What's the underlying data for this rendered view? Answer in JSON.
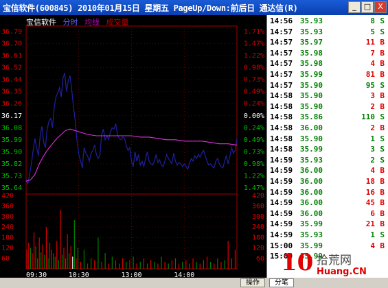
{
  "window": {
    "title": "宝信软件(600845) 2010年01月15日 星期五 PageUp/Down:前后日 通达信(R)",
    "btn_min": "_",
    "btn_max": "□",
    "btn_close": "X"
  },
  "legend": {
    "name": "宝信软件",
    "timeframe": "分时",
    "avg_line": "均线",
    "volume": "成交量"
  },
  "colors": {
    "price_line": "#2020a0",
    "avg_line": "#e030e0",
    "up": "#e00000",
    "down": "#008000",
    "neutral": "#000000"
  },
  "chart_data": [
    {
      "type": "line",
      "title": "",
      "x_ticks": [
        "09:30",
        "10:30",
        "13:00",
        "14:00"
      ],
      "y_left_ticks": [
        "36.79",
        "36.70",
        "36.61",
        "36.52",
        "36.44",
        "36.35",
        "36.26",
        "36.17",
        "36.08",
        "35.99",
        "35.90",
        "35.82",
        "35.73",
        "35.64"
      ],
      "y_right_ticks": [
        "1.71%",
        "1.47%",
        "1.22%",
        "0.98%",
        "0.73%",
        "0.49%",
        "0.24%",
        "0.00%",
        "0.24%",
        "0.49%",
        "0.73%",
        "0.98%",
        "1.22%",
        "1.47%"
      ],
      "ylim": [
        35.6,
        36.79
      ],
      "xlim": [
        0,
        240
      ],
      "series": [
        {
          "name": "分时",
          "x": [
            0,
            2,
            4,
            6,
            8,
            10,
            12,
            14,
            16,
            18,
            20,
            22,
            24,
            26,
            28,
            30,
            32,
            34,
            36,
            38,
            40,
            42,
            44,
            46,
            48,
            50,
            52,
            54,
            56,
            58,
            60,
            62,
            64,
            66,
            68,
            70,
            72,
            74,
            76,
            78,
            80,
            82,
            84,
            86,
            88,
            90,
            92,
            94,
            96,
            98,
            100,
            102,
            104,
            106,
            108,
            110,
            112,
            114,
            116,
            118,
            120,
            122,
            124,
            126,
            128,
            130,
            132,
            134,
            136,
            138,
            140,
            142,
            144,
            146,
            148,
            150,
            152,
            154,
            156,
            158,
            160,
            162,
            164,
            166,
            168,
            170,
            172,
            174,
            176,
            178,
            180,
            182,
            184,
            186,
            188,
            190,
            192,
            194,
            196,
            198,
            200,
            202,
            204,
            206,
            208,
            210,
            212,
            214,
            216,
            218,
            220,
            222,
            224,
            226,
            228,
            230,
            232,
            234,
            236,
            238,
            240
          ],
          "y": [
            35.66,
            35.63,
            35.7,
            35.78,
            35.88,
            35.97,
            35.9,
            35.84,
            35.99,
            36.06,
            35.94,
            35.9,
            36.04,
            36.1,
            36.12,
            36.05,
            36.2,
            36.28,
            36.31,
            36.35,
            36.28,
            36.42,
            36.46,
            36.32,
            36.4,
            36.44,
            36.33,
            36.2,
            36.1,
            35.95,
            35.85,
            35.8,
            35.75,
            35.9,
            35.86,
            35.84,
            35.8,
            35.86,
            35.88,
            35.92,
            35.85,
            35.82,
            35.84,
            36.0,
            36.04,
            35.96,
            35.99,
            35.96,
            36.02,
            36.05,
            36.04,
            36.08,
            36.0,
            35.97,
            35.96,
            35.98,
            35.97,
            35.92,
            35.88,
            35.9,
            35.8,
            35.76,
            35.87,
            35.8,
            35.85,
            35.77,
            35.8,
            35.76,
            35.82,
            35.87,
            35.8,
            35.78,
            35.77,
            35.8,
            35.85,
            35.79,
            35.81,
            35.77,
            35.76,
            35.8,
            35.85,
            35.82,
            35.8,
            35.78,
            35.86,
            35.8,
            35.77,
            35.79,
            35.78,
            35.76,
            35.78,
            35.76,
            35.74,
            35.78,
            35.82,
            35.8,
            35.84,
            35.82,
            35.85,
            35.83,
            35.86,
            35.88,
            35.84,
            35.8,
            35.77,
            35.78,
            35.76,
            35.75,
            35.8,
            35.82,
            35.78,
            35.76,
            35.75,
            35.8,
            35.84,
            35.78,
            35.84,
            35.9,
            35.86,
            35.88,
            35.97
          ]
        },
        {
          "name": "均线",
          "x": [
            0,
            5,
            10,
            15,
            20,
            25,
            30,
            35,
            40,
            45,
            50,
            55,
            60,
            70,
            80,
            90,
            100,
            110,
            120,
            130,
            140,
            150,
            160,
            170,
            180,
            190,
            200,
            210,
            220,
            230,
            240
          ],
          "y": [
            35.65,
            35.66,
            35.7,
            35.78,
            35.84,
            35.89,
            35.93,
            35.97,
            36.0,
            36.03,
            36.04,
            36.03,
            36.02,
            36.0,
            35.99,
            35.99,
            35.99,
            35.99,
            35.99,
            35.98,
            35.98,
            35.97,
            35.96,
            35.96,
            35.95,
            35.95,
            35.95,
            35.94,
            35.93,
            35.93,
            35.92
          ]
        }
      ]
    },
    {
      "type": "bar",
      "title": "",
      "y_ticks": [
        "420",
        "360",
        "300",
        "240",
        "180",
        "120",
        "60"
      ],
      "ylim": [
        0,
        430
      ],
      "xlim": [
        0,
        240
      ],
      "x": [
        1,
        3,
        5,
        7,
        9,
        11,
        13,
        15,
        17,
        19,
        21,
        23,
        25,
        27,
        29,
        31,
        33,
        35,
        37,
        39,
        41,
        43,
        45,
        47,
        49,
        51,
        53,
        55,
        57,
        59,
        62,
        66,
        70,
        74,
        78,
        82,
        86,
        90,
        94,
        98,
        102,
        106,
        110,
        114,
        118,
        122,
        126,
        130,
        134,
        138,
        142,
        146,
        150,
        154,
        158,
        162,
        166,
        170,
        174,
        178,
        182,
        186,
        190,
        194,
        198,
        202,
        206,
        210,
        214,
        218,
        222,
        226,
        230,
        234,
        238
      ],
      "values": [
        110,
        150,
        120,
        90,
        210,
        130,
        60,
        180,
        95,
        140,
        80,
        240,
        60,
        150,
        110,
        90,
        70,
        160,
        50,
        340,
        80,
        120,
        60,
        200,
        90,
        130,
        70,
        280,
        60,
        120,
        40,
        110,
        30,
        60,
        50,
        180,
        40,
        90,
        30,
        70,
        50,
        30,
        60,
        40,
        50,
        70,
        30,
        40,
        60,
        30,
        50,
        40,
        30,
        70,
        40,
        30,
        50,
        60,
        30,
        40,
        50,
        30,
        60,
        40,
        30,
        50,
        70,
        40,
        30,
        60,
        40,
        50,
        160,
        60,
        110
      ],
      "colors": [
        "up",
        "up",
        "down",
        "up",
        "up",
        "down",
        "up",
        "up",
        "down",
        "up",
        "down",
        "up",
        "down",
        "up",
        "down",
        "up",
        "down",
        "up",
        "down",
        "up",
        "down",
        "up",
        "down",
        "up",
        "down",
        "up",
        "neutral",
        "down",
        "up",
        "down",
        "up",
        "down",
        "up",
        "down",
        "up",
        "down",
        "up",
        "down",
        "up",
        "down",
        "up",
        "down",
        "up",
        "down",
        "up",
        "down",
        "up",
        "down",
        "up",
        "down",
        "up",
        "down",
        "up",
        "down",
        "up",
        "down",
        "up",
        "down",
        "up",
        "down",
        "up",
        "down",
        "up",
        "down",
        "up",
        "down",
        "up",
        "down",
        "up",
        "down",
        "up",
        "down",
        "up",
        "down",
        "up"
      ]
    }
  ],
  "quotes": [
    {
      "time": "14:56",
      "price": "35.93",
      "vol": "8",
      "side": "S"
    },
    {
      "time": "14:57",
      "price": "35.93",
      "vol": "5",
      "side": "S"
    },
    {
      "time": "14:57",
      "price": "35.97",
      "vol": "11",
      "side": "B"
    },
    {
      "time": "14:57",
      "price": "35.98",
      "vol": "7",
      "side": "B"
    },
    {
      "time": "14:57",
      "price": "35.98",
      "vol": "4",
      "side": "B"
    },
    {
      "time": "14:57",
      "price": "35.99",
      "vol": "81",
      "side": "B"
    },
    {
      "time": "14:57",
      "price": "35.90",
      "vol": "95",
      "side": "S"
    },
    {
      "time": "14:58",
      "price": "35.90",
      "vol": "3",
      "side": "B"
    },
    {
      "time": "14:58",
      "price": "35.90",
      "vol": "2",
      "side": "B"
    },
    {
      "time": "14:58",
      "price": "35.86",
      "vol": "110",
      "side": "S"
    },
    {
      "time": "14:58",
      "price": "36.00",
      "vol": "2",
      "side": "B"
    },
    {
      "time": "14:58",
      "price": "35.90",
      "vol": "1",
      "side": "S"
    },
    {
      "time": "14:58",
      "price": "35.99",
      "vol": "3",
      "side": "S"
    },
    {
      "time": "14:59",
      "price": "35.93",
      "vol": "2",
      "side": "S"
    },
    {
      "time": "14:59",
      "price": "36.00",
      "vol": "4",
      "side": "B"
    },
    {
      "time": "14:59",
      "price": "36.00",
      "vol": "18",
      "side": "B"
    },
    {
      "time": "14:59",
      "price": "36.00",
      "vol": "16",
      "side": "B"
    },
    {
      "time": "14:59",
      "price": "36.00",
      "vol": "45",
      "side": "B"
    },
    {
      "time": "14:59",
      "price": "36.00",
      "vol": "6",
      "side": "B"
    },
    {
      "time": "14:59",
      "price": "35.99",
      "vol": "21",
      "side": "B"
    },
    {
      "time": "14:59",
      "price": "35.93",
      "vol": "1",
      "side": "S"
    },
    {
      "time": "15:00",
      "price": "35.99",
      "vol": "4",
      "side": "B"
    },
    {
      "time": "15:00",
      "price": "35.99",
      "vol": "",
      "side": ""
    }
  ],
  "bottom": {
    "tab_ops": "操作",
    "tab_detail": "分笔"
  },
  "watermark": {
    "logo_digits": "10",
    "cn": "拾荒网",
    "en": "Huang.CN"
  }
}
